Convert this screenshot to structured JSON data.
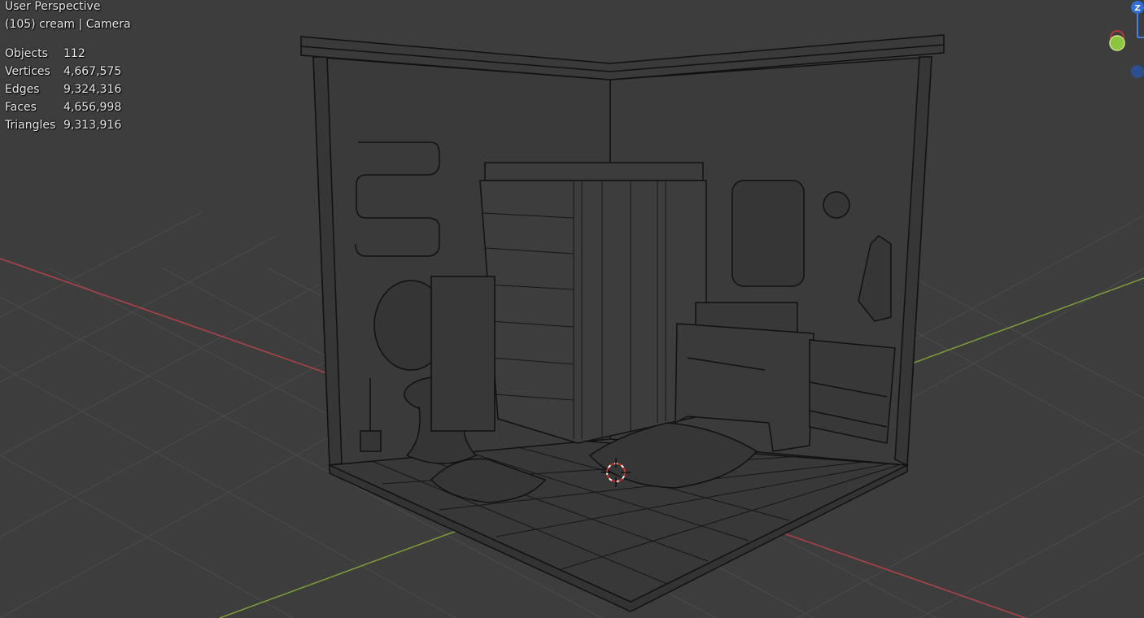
{
  "viewport": {
    "view_name": "User Perspective",
    "object_info": "(105) cream | Camera"
  },
  "stats": [
    {
      "label": "Objects",
      "value": "112"
    },
    {
      "label": "Vertices",
      "value": "4,667,575"
    },
    {
      "label": "Edges",
      "value": "9,324,316"
    },
    {
      "label": "Faces",
      "value": "4,656,998"
    },
    {
      "label": "Triangles",
      "value": "9,313,916"
    }
  ],
  "gizmo": {
    "z_label": "Z"
  },
  "colors": {
    "background": "#3d3d3d",
    "grid": "#4a4a4a",
    "x_axis": "#b0434b",
    "y_axis": "#7c9c3a",
    "wire": "#111111",
    "gizmo_z": "#2f6fd6",
    "gizmo_y": "#8cc33f",
    "cursor": "#d82424"
  }
}
